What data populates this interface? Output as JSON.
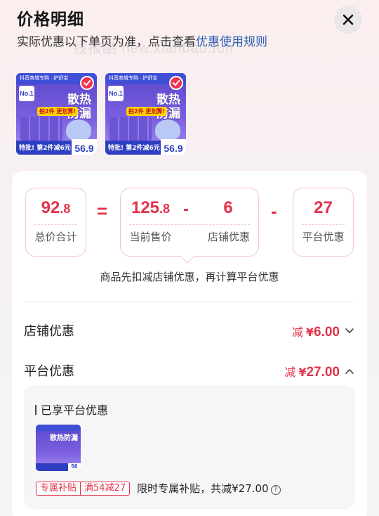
{
  "header": {
    "title": "价格明细",
    "subtitle_prefix": "实际优惠以下单页为准，点击查看",
    "subtitle_link": "优惠使用规则",
    "watermark": "线报酷 new.xianbao.fun"
  },
  "thumbnails": [
    {
      "brand": "抖音商城专购 · 护舒宝",
      "rank": "No.1",
      "headline_1": "散热",
      "headline_2": "防漏",
      "promo_pill": "拍2件 更划算!",
      "bottom_text": "特批! 第2件减6元",
      "price": "56.9",
      "selected": true
    },
    {
      "brand": "抖音商城专购 · 护舒宝",
      "rank": "No.1",
      "headline_1": "散热",
      "headline_2": "防漏",
      "promo_pill": "拍2件 更划算!",
      "bottom_text": "特批! 第2件减6元",
      "price": "56.9",
      "selected": true
    }
  ],
  "formula": {
    "total": {
      "int": "92",
      "dec": ".8",
      "label": "总价合计"
    },
    "equals": "=",
    "current": {
      "int": "125",
      "dec": ".8",
      "label": "当前售价"
    },
    "minus1": "-",
    "store": {
      "value": "6",
      "label": "店铺优惠"
    },
    "minus2": "-",
    "platform": {
      "value": "27",
      "label": "平台优惠"
    },
    "note": "商品先扣减店铺优惠，再计算平台优惠"
  },
  "store_discount": {
    "label": "店铺优惠",
    "prefix": "减",
    "currency": "¥",
    "amount": "6.00"
  },
  "platform_discount": {
    "label": "平台优惠",
    "prefix": "减",
    "currency": "¥",
    "amount": "27.00"
  },
  "enjoyed": {
    "heading": "已享平台优惠",
    "mini_thumb_text": "散热防漏",
    "mini_price": "56",
    "tag1": "专属补贴",
    "tag2": "满54减27",
    "description": "限时专属补贴，共减¥27.00"
  },
  "colors": {
    "accent": "#e4324a",
    "link": "#2a5fb0"
  }
}
